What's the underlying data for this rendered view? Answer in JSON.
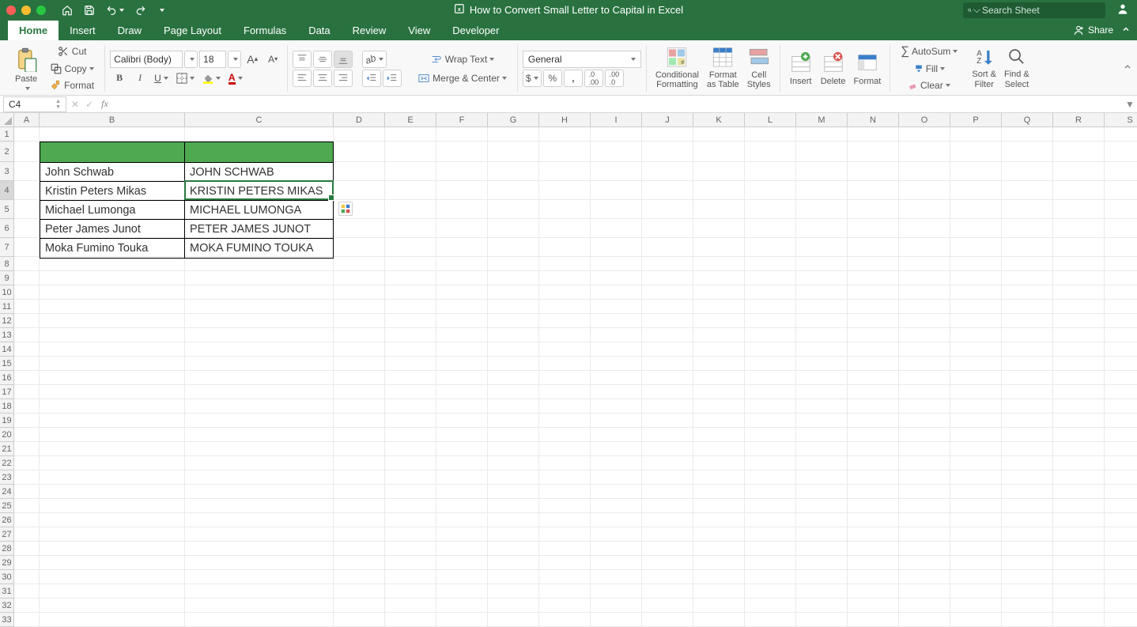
{
  "titlebar": {
    "title": "How to Convert Small Letter to Capital in Excel",
    "search_placeholder": "Search Sheet"
  },
  "tabs": {
    "items": [
      "Home",
      "Insert",
      "Draw",
      "Page Layout",
      "Formulas",
      "Data",
      "Review",
      "View",
      "Developer"
    ],
    "active": "Home",
    "share": "Share"
  },
  "ribbon": {
    "clipboard": {
      "paste": "Paste",
      "cut": "Cut",
      "copy": "Copy",
      "format_painter": "Format"
    },
    "font": {
      "name": "Calibri (Body)",
      "size": "18"
    },
    "alignment": {
      "wrap": "Wrap Text",
      "merge": "Merge & Center"
    },
    "number": {
      "format": "General"
    },
    "cond": {
      "conditional": "Conditional\nFormatting",
      "fas": "Format\nas Table",
      "styles": "Cell\nStyles"
    },
    "cells": {
      "insert": "Insert",
      "delete": "Delete",
      "format": "Format"
    },
    "editing": {
      "autosum": "AutoSum",
      "fill": "Fill",
      "clear": "Clear",
      "sort": "Sort &\nFilter",
      "find": "Find &\nSelect"
    }
  },
  "formula_bar": {
    "namebox": "C4",
    "formula": ""
  },
  "grid": {
    "columns": [
      "A",
      "B",
      "C",
      "D",
      "E",
      "F",
      "G",
      "H",
      "I",
      "J",
      "K",
      "L",
      "M",
      "N",
      "O",
      "P",
      "Q",
      "R",
      "S"
    ],
    "col_widths": {
      "A": 32,
      "B": 184,
      "C": 188,
      "default": 65
    },
    "row_heights": {
      "default": 18,
      "2": 26,
      "3": 24,
      "4": 24,
      "5": 24,
      "6": 24,
      "7": 24
    },
    "row_count": 33,
    "selected_row": 4,
    "selected_col": 3
  },
  "table": {
    "rows": [
      {
        "b": "John Schwab",
        "c": "JOHN SCHWAB"
      },
      {
        "b": "Kristin Peters Mikas",
        "c": "KRISTIN PETERS MIKAS"
      },
      {
        "b": "Michael Lumonga",
        "c": "MICHAEL LUMONGA"
      },
      {
        "b": "Peter James Junot",
        "c": "PETER JAMES JUNOT"
      },
      {
        "b": "Moka Fumino Touka",
        "c": "MOKA FUMINO TOUKA"
      }
    ]
  }
}
